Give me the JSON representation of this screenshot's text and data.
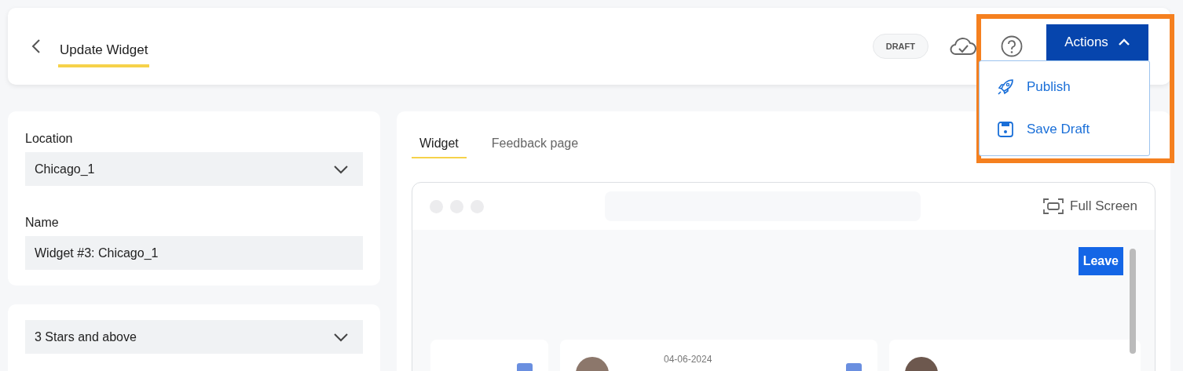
{
  "header": {
    "title": "Update Widget",
    "status_badge": "DRAFT",
    "actions_button": "Actions",
    "menu_expanded": true,
    "menu": [
      {
        "kind": "publish",
        "label": "Publish"
      },
      {
        "kind": "save",
        "label": "Save Draft"
      }
    ]
  },
  "settings": {
    "fields": [
      {
        "kind": "select",
        "label": "Location",
        "value": "Chicago_1"
      },
      {
        "kind": "text",
        "label": "Name",
        "value": "Widget #3: Chicago_1"
      }
    ],
    "rating_filter": "3 Stars and above"
  },
  "preview": {
    "tabs": [
      {
        "label": "Widget",
        "selected": true
      },
      {
        "label": "Feedback page",
        "selected": false
      }
    ],
    "full_screen": "Full Screen",
    "leave_button": "Leave",
    "reviews": [
      {
        "kind": "partial"
      },
      {
        "kind": "full",
        "date": "04-06-2024"
      },
      {
        "kind": "full"
      }
    ]
  }
}
